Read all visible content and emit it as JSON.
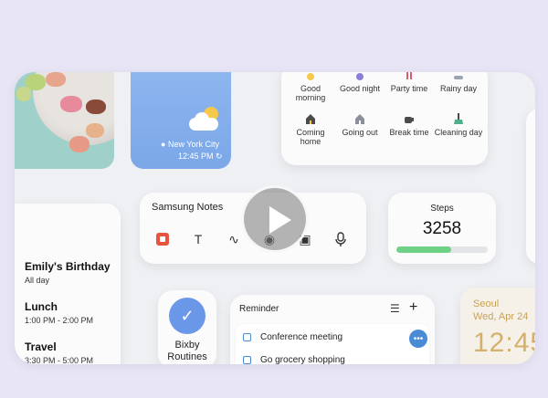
{
  "weather": {
    "city": "New York City",
    "time": "12:45 PM"
  },
  "modes": [
    {
      "label": "Good morning",
      "icon": "sun-icon"
    },
    {
      "label": "Good night",
      "icon": "moon-icon"
    },
    {
      "label": "Party time",
      "icon": "party-icon"
    },
    {
      "label": "Rainy day",
      "icon": "rain-icon"
    },
    {
      "label": "Coming home",
      "icon": "house-icon"
    },
    {
      "label": "Going out",
      "icon": "house-out-icon"
    },
    {
      "label": "Break time",
      "icon": "coffee-icon"
    },
    {
      "label": "Cleaning day",
      "icon": "broom-icon"
    }
  ],
  "notes": {
    "title": "Samsung Notes",
    "tools": [
      "note-icon",
      "text-icon",
      "pen-icon",
      "palette-icon",
      "image-icon",
      "mic-icon"
    ]
  },
  "steps": {
    "label": "Steps",
    "count": "3258",
    "progress": 0.6,
    "accent": "#6fd186"
  },
  "calendar": {
    "events": [
      {
        "name": "Emily's Birthday",
        "when": "All day",
        "color": "#8a7fd6"
      },
      {
        "name": "Lunch",
        "when": "1:00 PM - 2:00 PM",
        "color": "#e25c6a"
      },
      {
        "name": "Travel",
        "when": "3:30 PM - 5:00 PM",
        "color": "#f0a14a"
      }
    ]
  },
  "bixby": {
    "label": "Bixby Routines"
  },
  "reminder": {
    "title": "Reminder",
    "items": [
      "Conference meeting",
      "Go grocery shopping"
    ]
  },
  "clock": {
    "city": "Seoul",
    "date": "Wed, Apr 24",
    "time": "12:45"
  }
}
